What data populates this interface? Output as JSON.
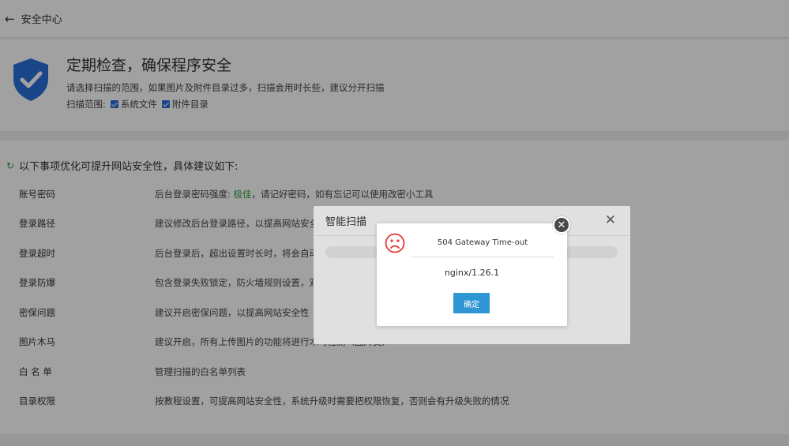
{
  "header": {
    "back_icon": "arrow-left-icon",
    "title": "安全中心"
  },
  "hero": {
    "icon": "shield-check-icon",
    "title": "定期检查，确保程序安全",
    "description": "请选择扫描的范围，如果图片及附件目录过多，扫描会用时长些，建议分开扫描",
    "scope_label": "扫描范围:",
    "scope_options": [
      {
        "label": "系统文件",
        "checked": true
      },
      {
        "label": "附件目录",
        "checked": true
      }
    ]
  },
  "list": {
    "heading": "以下事项优化可提升网站安全性，具体建议如下:",
    "items": [
      {
        "key": "账号密码",
        "prefix": "后台登录密码强度: ",
        "highlight": "极佳",
        "suffix": "，请记好密码，如有忘记可以使用改密小工具"
      },
      {
        "key": "登录路径",
        "value": "建议修改后台登录路径，以提高网站安全"
      },
      {
        "key": "登录超时",
        "value": "后台登录后，超出设置时长时，将会自动"
      },
      {
        "key": "登录防爆",
        "value": "包含登录失败锁定，防火墙规则设置，双"
      },
      {
        "key": "密保问题",
        "value": "建议开启密保问题，以提高网站安全性（"
      },
      {
        "key": "图片木马",
        "value": "建议开启，所有上传图片的功能将进行木马检测（图片类）"
      },
      {
        "key": "白 名 单",
        "value": "管理扫描的白名单列表"
      },
      {
        "key": "目录权限",
        "value": "按教程设置，可提高网站安全性，系统升级时需要把权限恢复，否则会有升级失败的情况"
      }
    ]
  },
  "scan_dialog": {
    "title": "智能扫描",
    "close_icon": "close-icon"
  },
  "error_dialog": {
    "icon": "sad-face-icon",
    "title": "504 Gateway Time-out",
    "message": "nginx/1.26.1",
    "confirm": "确定",
    "close_icon": "close-circle-icon"
  },
  "colors": {
    "accent": "#2f96d4",
    "good": "#2e9e3c",
    "shield": "#2a6fd8",
    "error": "#e53935"
  }
}
